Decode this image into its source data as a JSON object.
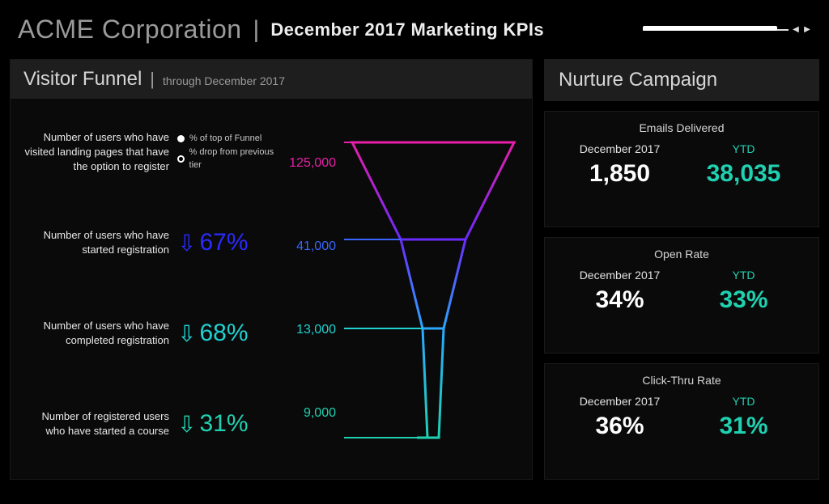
{
  "header": {
    "company": "ACME Corporation",
    "subtitle": "December 2017 Marketing KPIs"
  },
  "funnel": {
    "title": "Visitor Funnel",
    "subtitle": "through December 2017",
    "legend": {
      "top": "% of top of Funnel",
      "drop": "% drop from previous tier"
    },
    "stages": [
      {
        "label": "Number of users who have visited landing pages that have the option to register",
        "count": "125,000",
        "color": "#e81fa8"
      },
      {
        "label": "Number of users who have started registration",
        "count": "41,000",
        "drop": "67%",
        "drop_color": "#2a2aff",
        "color": "#3a3aff"
      },
      {
        "label": "Number of users who have completed registration",
        "count": "13,000",
        "drop": "68%",
        "drop_color": "#1fd1d1",
        "color": "#1fd1d1"
      },
      {
        "label": "Number of registered users who have started a course",
        "count": "9,000",
        "drop": "31%",
        "drop_color": "#1fd1b1",
        "color": "#1fd1b1"
      }
    ]
  },
  "nurture": {
    "title": "Nurture Campaign",
    "period_label": "December 2017",
    "ytd_label": "YTD",
    "cards": [
      {
        "heading": "Emails Delivered",
        "period": "1,850",
        "ytd": "38,035"
      },
      {
        "heading": "Open Rate",
        "period": "34%",
        "ytd": "33%"
      },
      {
        "heading": "Click-Thru Rate",
        "period": "36%",
        "ytd": "31%"
      }
    ]
  },
  "chart_data": {
    "type": "funnel",
    "title": "Visitor Funnel through December 2017",
    "series": [
      {
        "name": "Visited landing pages with register option",
        "value": 125000
      },
      {
        "name": "Started registration",
        "value": 41000,
        "drop_from_prev_pct": 67
      },
      {
        "name": "Completed registration",
        "value": 13000,
        "drop_from_prev_pct": 68
      },
      {
        "name": "Started a course",
        "value": 9000,
        "drop_from_prev_pct": 31
      }
    ],
    "annotations": [
      "% of top of Funnel",
      "% drop from previous tier"
    ]
  }
}
